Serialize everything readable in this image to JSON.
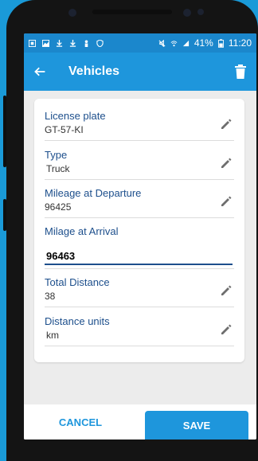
{
  "status_bar": {
    "battery": "41%",
    "time": "11:20"
  },
  "app_bar": {
    "title": "Vehicles"
  },
  "fields": {
    "license_plate": {
      "label": "License plate",
      "value": "GT-57-KI"
    },
    "type": {
      "label": "Type",
      "value": "Truck"
    },
    "mileage_departure": {
      "label": "Mileage at Departure",
      "value": "96425"
    },
    "mileage_arrival": {
      "label": "Milage at Arrival",
      "value": "96463"
    },
    "total_distance": {
      "label": "Total Distance",
      "value": "38"
    },
    "distance_units": {
      "label": "Distance units",
      "value": "km"
    }
  },
  "buttons": {
    "cancel": "CANCEL",
    "save": "SAVE"
  },
  "colors": {
    "background": "#1a9ad8",
    "appbar": "#1e96dc",
    "statusbar": "#1b87cc",
    "label": "#1d4f8c"
  },
  "icons": [
    "back-arrow-icon",
    "trash-icon",
    "pencil-icon"
  ]
}
